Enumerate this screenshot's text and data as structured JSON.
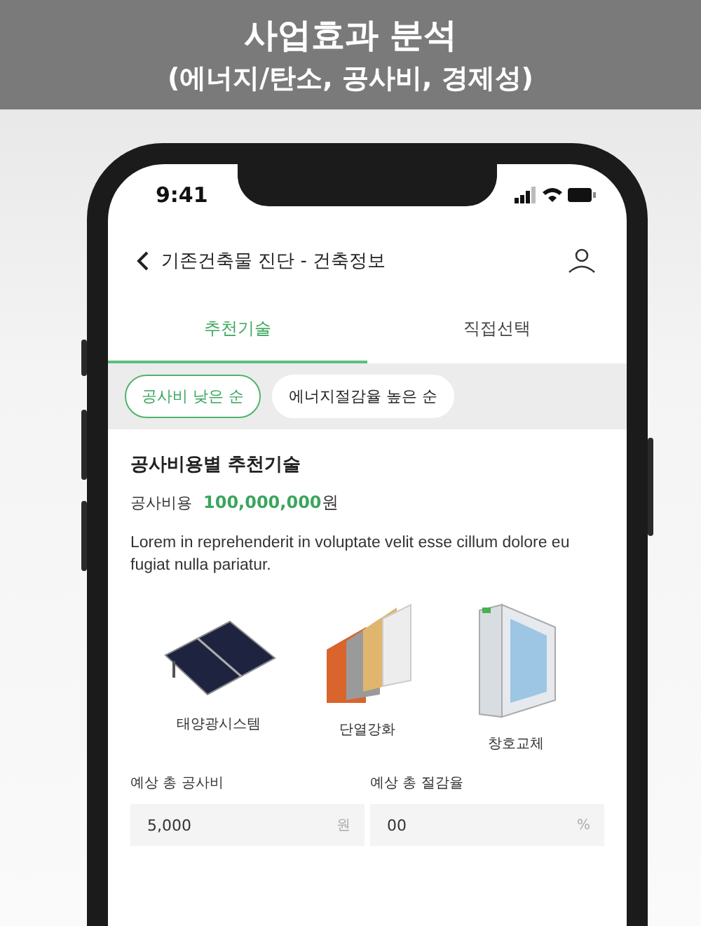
{
  "banner": {
    "title": "사업효과 분석",
    "subtitle": "(에너지/탄소, 공사비, 경제성)"
  },
  "status_bar": {
    "time": "9:41"
  },
  "nav": {
    "title": "기존건축물 진단 - 건축정보"
  },
  "tabs": [
    {
      "label": "추천기술",
      "selected": true
    },
    {
      "label": "직접선택",
      "selected": false
    }
  ],
  "sort_chips": [
    {
      "label": "공사비 낮은 순",
      "selected": true
    },
    {
      "label": "에너지절감율 높은 순",
      "selected": false
    }
  ],
  "section": {
    "heading": "공사비용별 추천기술",
    "cost_label": "공사비용",
    "cost_value": "100,000,000",
    "cost_unit": "원",
    "description": "Lorem in reprehenderit in voluptate velit esse cillum dolore eu fugiat nulla pariatur."
  },
  "technologies": [
    {
      "kind": "solar",
      "label": "태양광시스템"
    },
    {
      "kind": "insulation",
      "label": "단열강화"
    },
    {
      "kind": "window",
      "label": "창호교체"
    }
  ],
  "estimates": [
    {
      "label": "예상 총 공사비",
      "value": "5,000",
      "unit": "원"
    },
    {
      "label": "예상 총 절감율",
      "value": "00",
      "unit": "%"
    }
  ]
}
